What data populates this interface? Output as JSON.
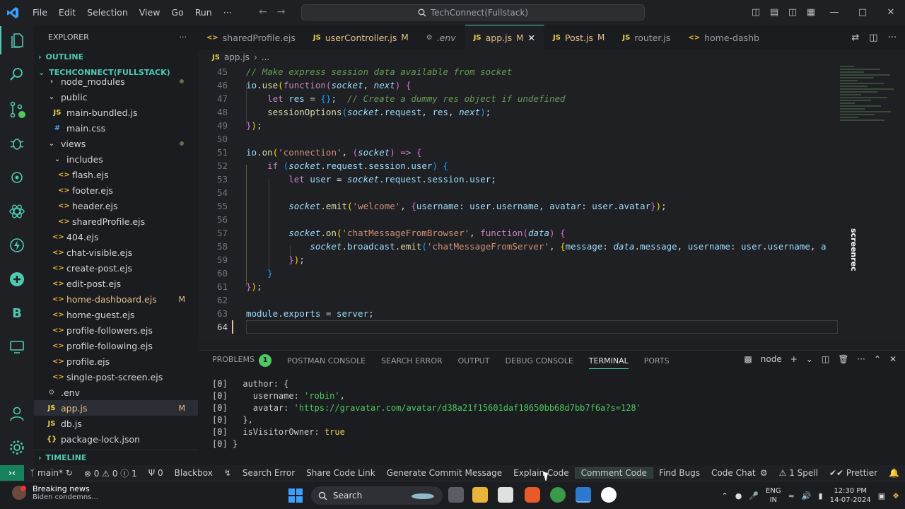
{
  "titlebar": {
    "menu": [
      "File",
      "Edit",
      "Selection",
      "View",
      "Go",
      "Run",
      "···"
    ],
    "search": "TechConnect(Fullstack)"
  },
  "sidebar": {
    "title": "EXPLORER",
    "outline": "OUTLINE",
    "project": "TECHCONNECT(FULLSTACK)",
    "timeline": "TIMELINE",
    "items": [
      {
        "label": "node_modules",
        "kind": "folder",
        "depth": 1
      },
      {
        "label": "public",
        "kind": "folder-open",
        "depth": 1
      },
      {
        "label": "main-bundled.js",
        "kind": "js",
        "depth": 2
      },
      {
        "label": "main.css",
        "kind": "css",
        "depth": 2
      },
      {
        "label": "views",
        "kind": "folder-open",
        "depth": 1
      },
      {
        "label": "includes",
        "kind": "folder-open",
        "depth": 2
      },
      {
        "label": "flash.ejs",
        "kind": "ejs",
        "depth": 3
      },
      {
        "label": "footer.ejs",
        "kind": "ejs",
        "depth": 3
      },
      {
        "label": "header.ejs",
        "kind": "ejs",
        "depth": 3
      },
      {
        "label": "sharedProfile.ejs",
        "kind": "ejs",
        "depth": 3
      },
      {
        "label": "404.ejs",
        "kind": "ejs",
        "depth": 2
      },
      {
        "label": "chat-visible.ejs",
        "kind": "ejs",
        "depth": 2
      },
      {
        "label": "create-post.ejs",
        "kind": "ejs",
        "depth": 2
      },
      {
        "label": "edit-post.ejs",
        "kind": "ejs",
        "depth": 2
      },
      {
        "label": "home-dashboard.ejs",
        "kind": "ejs",
        "depth": 2,
        "badge": "M"
      },
      {
        "label": "home-guest.ejs",
        "kind": "ejs",
        "depth": 2
      },
      {
        "label": "profile-followers.ejs",
        "kind": "ejs",
        "depth": 2
      },
      {
        "label": "profile-following.ejs",
        "kind": "ejs",
        "depth": 2
      },
      {
        "label": "profile.ejs",
        "kind": "ejs",
        "depth": 2
      },
      {
        "label": "single-post-screen.ejs",
        "kind": "ejs",
        "depth": 2
      },
      {
        "label": ".env",
        "kind": "env",
        "depth": 1
      },
      {
        "label": "app.js",
        "kind": "js",
        "depth": 1,
        "badge": "M",
        "selected": true
      },
      {
        "label": "db.js",
        "kind": "js",
        "depth": 1
      },
      {
        "label": "package-lock.json",
        "kind": "json",
        "depth": 1
      }
    ]
  },
  "tabs": [
    {
      "label": "sharedProfile.ejs",
      "kind": "ejs"
    },
    {
      "label": "userController.js",
      "kind": "js",
      "badge": "M"
    },
    {
      "label": ".env",
      "kind": "env"
    },
    {
      "label": "app.js",
      "kind": "js",
      "badge": "M",
      "active": true
    },
    {
      "label": "Post.js",
      "kind": "js",
      "badge": "M"
    },
    {
      "label": "router.js",
      "kind": "js"
    },
    {
      "label": "home-dashb",
      "kind": "ejs"
    }
  ],
  "breadcrumb": {
    "file": "app.js",
    "rest": "..."
  },
  "editor": {
    "lines": [
      {
        "n": "45",
        "html": "<span class='cm'>// Make express session data available from socket</span>",
        "indent": 0
      },
      {
        "n": "46",
        "html": "<span class='var'>io</span>.<span class='fn'>use</span><span class='br1'>(</span><span class='kw'>function</span><span class='br2'>(</span><span class='it'>socket</span>, <span class='it'>next</span><span class='br2'>)</span> <span class='br2'>{</span>",
        "indent": 0
      },
      {
        "n": "47",
        "html": "    <span class='kw'>let</span> <span class='var'>res</span> = <span class='br3'>{}</span>;  <span class='cm'>// Create a dummy res object if undefined</span>",
        "indent": 0
      },
      {
        "n": "48",
        "html": "    <span class='fn'>sessionOptions</span><span class='br3'>(</span><span class='it'>socket</span>.<span class='var'>request</span>, <span class='var'>res</span>, <span class='it'>next</span><span class='br3'>)</span>;",
        "indent": 0
      },
      {
        "n": "49",
        "html": "<span class='br2'>}</span><span class='br1'>)</span>;",
        "indent": 0
      },
      {
        "n": "50",
        "html": "",
        "indent": 0
      },
      {
        "n": "51",
        "html": "<span class='var'>io</span>.<span class='fn'>on</span><span class='br1'>(</span><span class='str'>'connection'</span>, <span class='br2'>(</span><span class='it'>socket</span><span class='br2'>)</span> <span class='kw'>=&gt;</span> <span class='br2'>{</span>",
        "indent": 0
      },
      {
        "n": "52",
        "html": "    <span class='kw'>if</span> <span class='br3'>(</span><span class='it'>socket</span>.<span class='var'>request</span>.<span class='var'>session</span>.<span class='var'>user</span><span class='br3'>)</span> <span class='br3'>{</span>",
        "indent": 0
      },
      {
        "n": "53",
        "html": "        <span class='kw'>let</span> <span class='var'>user</span> = <span class='it'>socket</span>.<span class='var'>request</span>.<span class='var'>session</span>.<span class='var'>user</span>;",
        "indent": 0
      },
      {
        "n": "54",
        "html": "",
        "indent": 0
      },
      {
        "n": "55",
        "html": "        <span class='it'>socket</span>.<span class='fn'>emit</span><span class='br1'>(</span><span class='str'>'welcome'</span>, <span class='br2'>{</span><span class='var'>username</span>: <span class='var'>user</span>.<span class='var'>username</span>, <span class='var'>avatar</span>: <span class='var'>user</span>.<span class='var'>avatar</span><span class='br2'>}</span><span class='br1'>)</span>;",
        "indent": 0
      },
      {
        "n": "56",
        "html": "",
        "indent": 0
      },
      {
        "n": "57",
        "html": "        <span class='it'>socket</span>.<span class='fn'>on</span><span class='br1'>(</span><span class='str'>'chatMessageFromBrowser'</span>, <span class='kw'>function</span><span class='br2'>(</span><span class='it'>data</span><span class='br2'>)</span> <span class='br2'>{</span>",
        "indent": 0
      },
      {
        "n": "58",
        "html": "            <span class='it'>socket</span>.<span class='var'>broadcast</span>.<span class='fn'>emit</span><span class='br3'>(</span><span class='str'>'chatMessageFromServer'</span>, <span class='br1'>{</span><span class='var'>message</span>: <span class='it'>data</span>.<span class='var'>message</span>, <span class='var'>username</span>: <span class='var'>user</span>.<span class='var'>username</span>, <span class='var'>a</span>",
        "indent": 0
      },
      {
        "n": "59",
        "html": "        <span class='br2'>}</span><span class='br1'>)</span>;",
        "indent": 0
      },
      {
        "n": "60",
        "html": "    <span class='br3'>}</span>",
        "indent": 0
      },
      {
        "n": "61",
        "html": "<span class='br2'>}</span><span class='br1'>)</span>;",
        "indent": 0
      },
      {
        "n": "62",
        "html": "",
        "indent": 0
      },
      {
        "n": "63",
        "html": "<span class='var'>module</span>.<span class='var'>exports</span> = <span class='var'>server</span>;",
        "indent": 0
      },
      {
        "n": "64",
        "html": "",
        "indent": 0,
        "current": true
      }
    ],
    "watermark": "screenrec"
  },
  "panel": {
    "tabs": [
      "PROBLEMS",
      "POSTMAN CONSOLE",
      "SEARCH ERROR",
      "OUTPUT",
      "DEBUG CONSOLE",
      "TERMINAL",
      "PORTS"
    ],
    "problems_count": "1",
    "active_tab": "TERMINAL",
    "shell": "node",
    "terminal": [
      {
        "html": "[0]   author: {"
      },
      {
        "html": "[0]     username: <span class='tstr'>'robin'</span>,"
      },
      {
        "html": "[0]     avatar: <span class='tstr'>'https://gravatar.com/avatar/d38a21f15601daf18650bb68d7bb7f6a?s=128'</span>"
      },
      {
        "html": "[0]   },"
      },
      {
        "html": "[0]   isVisitorOwner: <span class='tbool'>true</span>"
      },
      {
        "html": "[0] }"
      },
      {
        "html": ""
      }
    ]
  },
  "status": {
    "branch": "main*",
    "errors": "0",
    "warnings": "0",
    "info": "1",
    "ports": "0",
    "items": [
      "Blackbox",
      "Search Error",
      "Share Code Link",
      "Generate Commit Message",
      "Explain Code",
      "Comment Code",
      "Find Bugs",
      "Code Chat"
    ],
    "spell": "1 Spell",
    "prettier": "Prettier"
  },
  "taskbar": {
    "news_title": "Breaking news",
    "news_sub": "Biden condemns...",
    "search": "Search",
    "lang1": "ENG",
    "lang2": "IN",
    "time": "12:30 PM",
    "date": "14-07-2024"
  },
  "colors": {
    "accent": "#4ec9b0",
    "modified": "#e2c08d"
  }
}
